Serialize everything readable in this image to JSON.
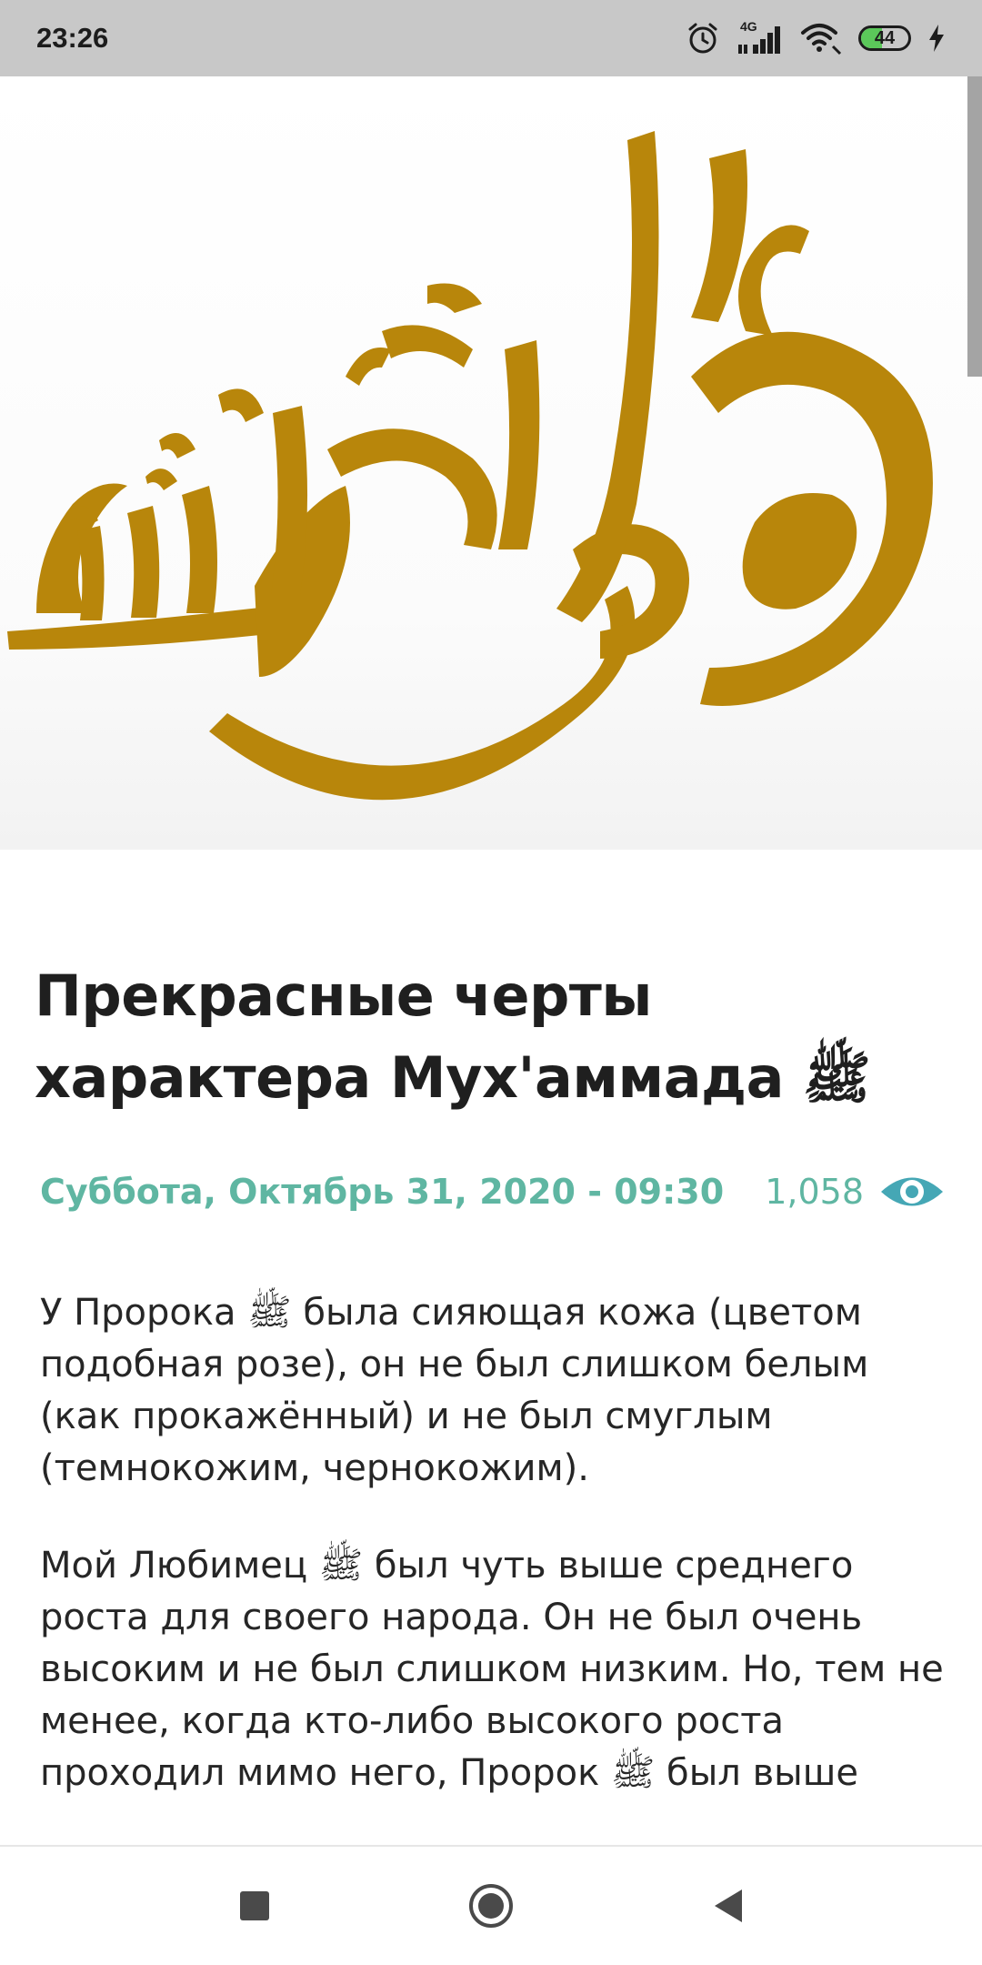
{
  "status_bar": {
    "time": "23:26",
    "network_label": "4G",
    "battery_level": "44"
  },
  "hero": {
    "image_icon": "golden-arabic-calligraphy",
    "calligraphy_color": "#b8860b"
  },
  "article": {
    "title": "Прекрасные черты характера Мух'аммада ﷺ",
    "date": "Суббота, Октябрь 31, 2020 - 09:30",
    "views": "1,058",
    "views_icon": "eye-icon",
    "paragraphs": [
      "У Пророка ﷺ была сияющая кожа (цветом подобная розе), он не был слишком белым (как прокажённый) и не был смуглым (темнокожим, чернокожим).",
      "Мой Любимец ﷺ был чуть выше среднего роста для своего народа. Он не был очень высоким и не был слишком низким. Но, тем не менее, когда кто-либо высокого роста проходил мимо него, Пророк ﷺ был выше"
    ]
  },
  "nav_bar": {
    "recents_icon": "square-icon",
    "home_icon": "circle-icon",
    "back_icon": "triangle-back-icon"
  },
  "colors": {
    "accent": "#5fb6a2",
    "eye_icon": "#45a7b5",
    "status_bar_bg": "#c8c8c8",
    "text": "#262626"
  }
}
